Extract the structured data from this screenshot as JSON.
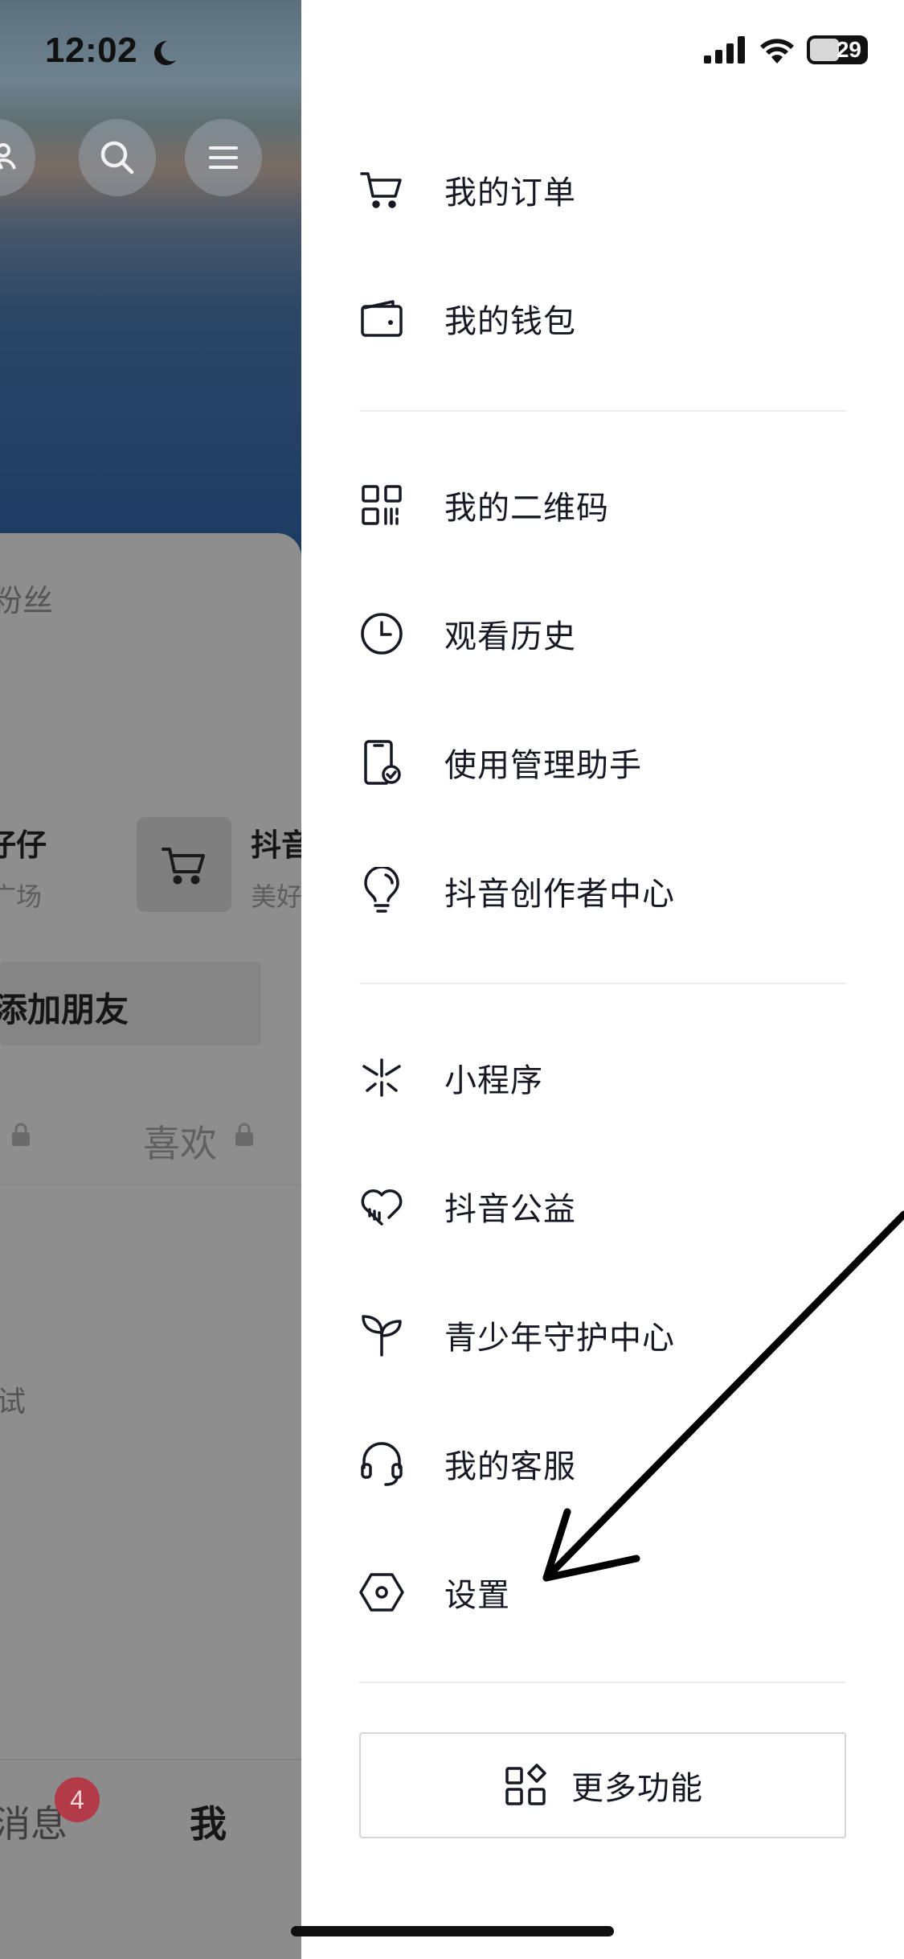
{
  "status_bar": {
    "time": "12:02",
    "battery": "29"
  },
  "background": {
    "fans_label": "粉丝",
    "card1_title": "仔仔",
    "card1_sub": "广场",
    "card2_title": "抖音",
    "card2_sub": "美好",
    "add_friend_label": "添加朋友",
    "tab_like": "喜欢",
    "tip_text": "试",
    "nav_messages": "消息",
    "nav_messages_badge": "4",
    "nav_me": "我"
  },
  "drawer": {
    "items": [
      {
        "label": "我的订单",
        "icon": "cart-icon"
      },
      {
        "label": "我的钱包",
        "icon": "wallet-icon"
      },
      {
        "label": "我的二维码",
        "icon": "qr-code-icon"
      },
      {
        "label": "观看历史",
        "icon": "clock-icon"
      },
      {
        "label": "使用管理助手",
        "icon": "phone-check-icon"
      },
      {
        "label": "抖音创作者中心",
        "icon": "lightbulb-icon"
      },
      {
        "label": "小程序",
        "icon": "mini-program-icon"
      },
      {
        "label": "抖音公益",
        "icon": "heart-charity-icon"
      },
      {
        "label": "青少年守护中心",
        "icon": "sprout-icon"
      },
      {
        "label": "我的客服",
        "icon": "headset-icon"
      },
      {
        "label": "设置",
        "icon": "hexagon-settings-icon"
      }
    ],
    "more_label": "更多功能"
  },
  "colors": {
    "accent_badge": "#b33a48",
    "text": "#161823",
    "divider": "#ececec"
  }
}
